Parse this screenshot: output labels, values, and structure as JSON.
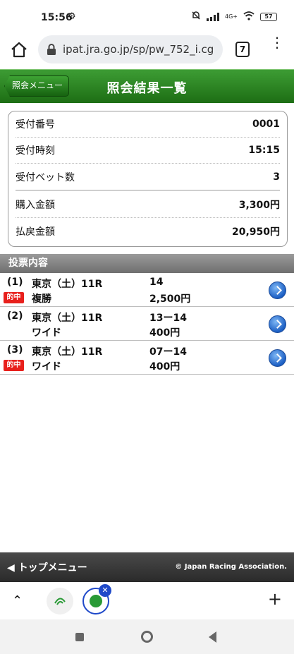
{
  "status_bar": {
    "time": "15:56",
    "network": "4G+",
    "battery": "57"
  },
  "browser": {
    "url": "ipat.jra.go.jp/sp/pw_752_i.cg",
    "tab_count": "7"
  },
  "header": {
    "back_label": "照会メニュー",
    "title": "照会結果一覧"
  },
  "summary": {
    "rows": [
      {
        "label": "受付番号",
        "value": "0001"
      },
      {
        "label": "受付時刻",
        "value": "15:15"
      },
      {
        "label": "受付ベット数",
        "value": "3"
      },
      {
        "label": "購入金額",
        "value": "3,300円"
      },
      {
        "label": "払戻金額",
        "value": "20,950円"
      }
    ]
  },
  "section": {
    "title": "投票内容"
  },
  "bets": [
    {
      "num": "(1)",
      "race": "東京（土）11R",
      "type": "複勝",
      "combo": "14",
      "amount": "2,500円",
      "hit": true,
      "hit_label": "的中"
    },
    {
      "num": "(2)",
      "race": "東京（土）11R",
      "type": "ワイド",
      "combo": "13ー14",
      "amount": "400円",
      "hit": false,
      "hit_label": ""
    },
    {
      "num": "(3)",
      "race": "東京（土）11R",
      "type": "ワイド",
      "combo": "07ー14",
      "amount": "400円",
      "hit": true,
      "hit_label": "的中"
    }
  ],
  "footer": {
    "top_menu": "◀ トップメニュー",
    "copyright": "© Japan Racing Association."
  },
  "colors": {
    "header_green": "#1d6e14",
    "hit_red": "#e8201c",
    "arrow_blue": "#1c5fc4"
  }
}
